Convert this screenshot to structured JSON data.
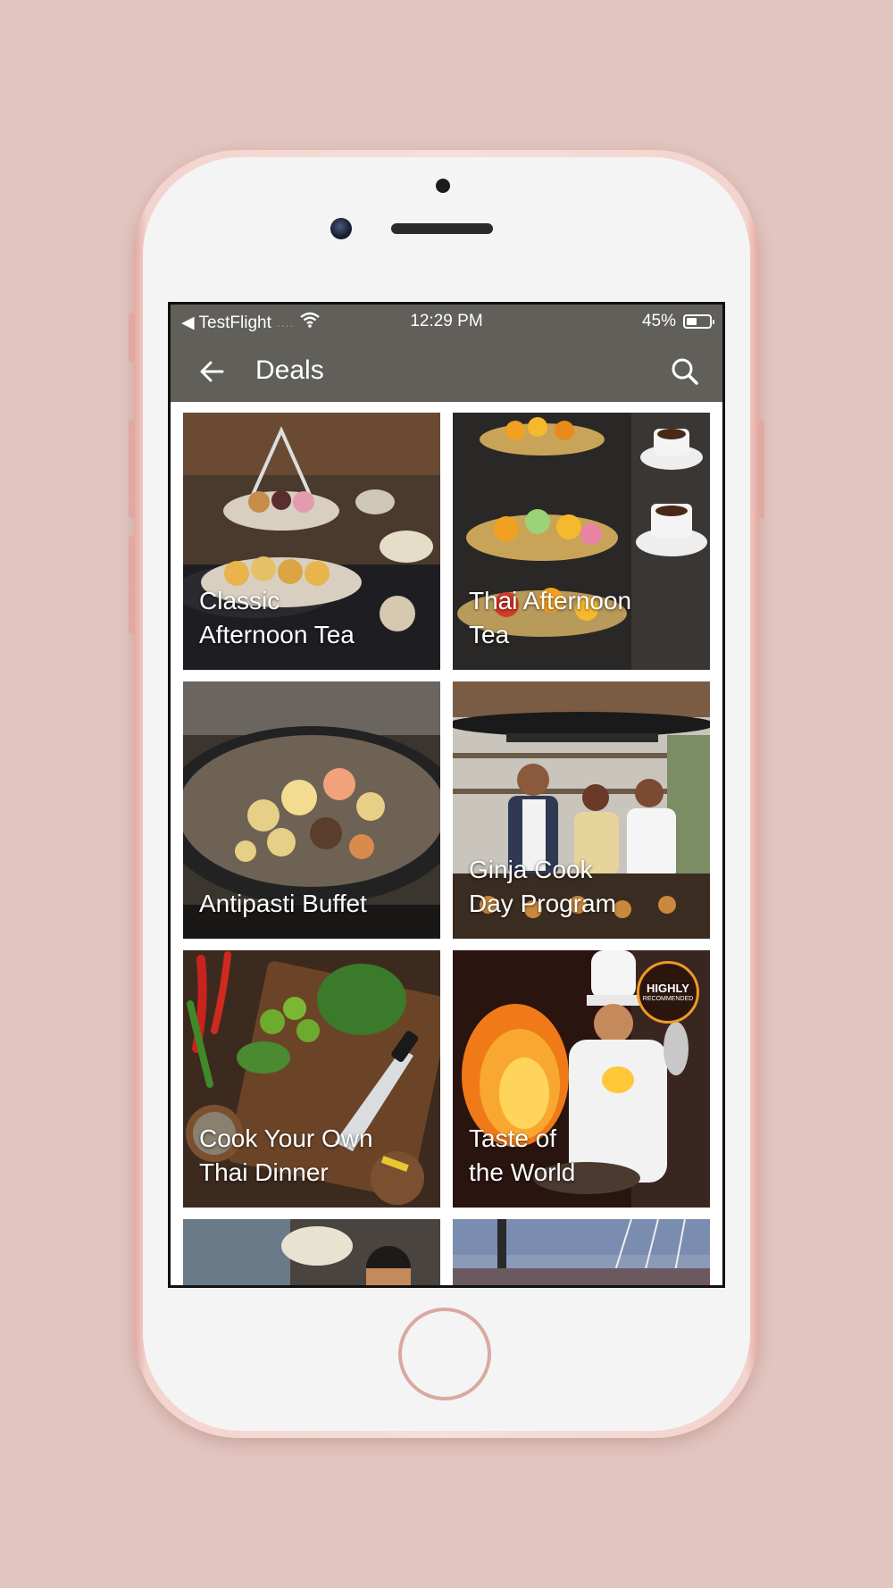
{
  "status_bar": {
    "carrier": "◀ TestFlight",
    "signal": "....",
    "time": "12:29 PM",
    "battery": "45%",
    "battery_level": 0.45
  },
  "header": {
    "title": "Deals",
    "back_icon": "arrow-left-icon",
    "search_icon": "search-icon"
  },
  "deals": [
    {
      "title_line1": "Classic",
      "title_line2": "Afternoon Tea"
    },
    {
      "title_line1": "Thai Afternoon",
      "title_line2": "Tea"
    },
    {
      "title_line1": "Antipasti Buffet",
      "title_line2": ""
    },
    {
      "title_line1": "Ginja Cook",
      "title_line2": "Day Program"
    },
    {
      "title_line1": "Cook Your Own",
      "title_line2": "Thai Dinner"
    },
    {
      "title_line1": "Taste of",
      "title_line2": "the World",
      "badge_line1": "HIGHLY",
      "badge_line2": "RECOMMENDED"
    }
  ],
  "colors": {
    "background": "#e3c5bf",
    "app_bar": "#615f5a",
    "badge_ring": "#f09a22"
  }
}
